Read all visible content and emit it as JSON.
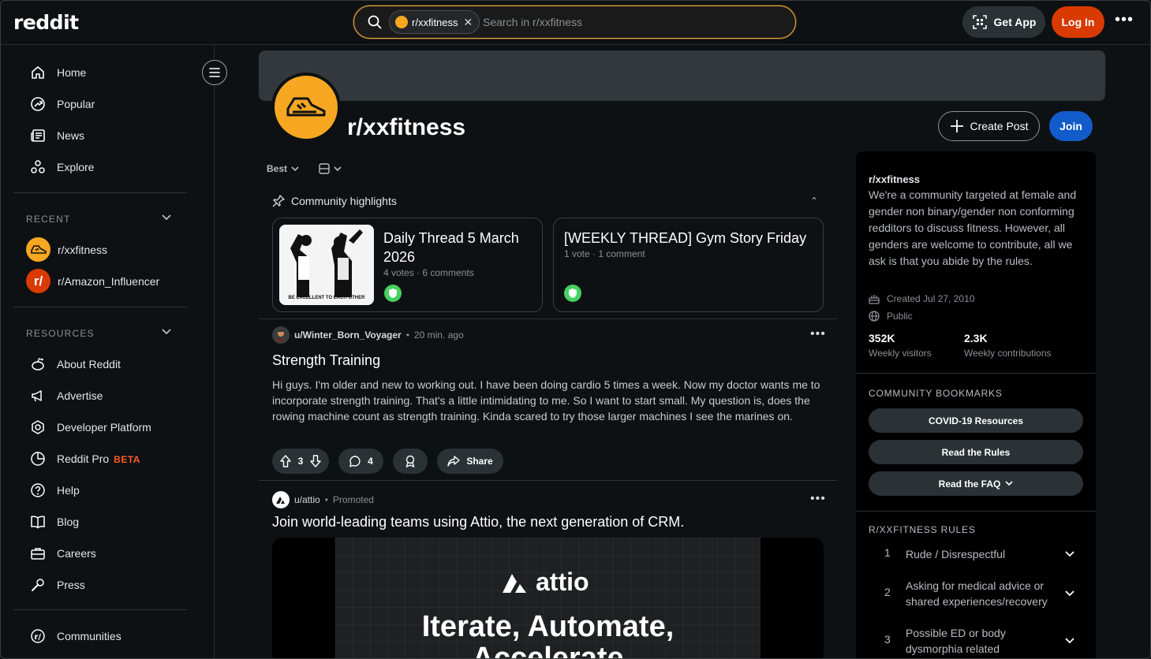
{
  "header": {
    "logo": "reddit",
    "search_chip": "r/xxfitness",
    "search_placeholder": "Search in r/xxfitness",
    "get_app": "Get App",
    "login": "Log In"
  },
  "sidebar": {
    "nav": [
      "Home",
      "Popular",
      "News",
      "Explore"
    ],
    "recent_label": "RECENT",
    "recent": [
      "r/xxfitness",
      "r/Amazon_Influencer"
    ],
    "resources_label": "RESOURCES",
    "resources": [
      "About Reddit",
      "Advertise",
      "Developer Platform",
      "Reddit Pro",
      "Help",
      "Blog",
      "Careers",
      "Press"
    ],
    "beta_label": "BETA",
    "communities": "Communities"
  },
  "subreddit": {
    "name": "r/xxfitness",
    "create_post": "Create Post",
    "join": "Join"
  },
  "feed": {
    "sort": "Best",
    "highlights_label": "Community highlights",
    "highlights": [
      {
        "title": "Daily Thread 5 March 2026",
        "meta": "4 votes · 6 comments",
        "thumb_caption": "BE EXCELLENT TO EACH OTHER"
      },
      {
        "title": "[WEEKLY THREAD] Gym Story Friday",
        "meta": "1 vote · 1 comment"
      }
    ],
    "post": {
      "user": "u/Winter_Born_Voyager",
      "time": "20 min. ago",
      "title": "Strength Training",
      "body": "Hi guys. I'm older and new to working out. I have been doing cardio 5 times a week. Now my doctor wants me to incorporate strength training. That's a little intimidating to me. So I want to start small. My question is, does the rowing machine count as strength training. Kinda scared to try those larger machines I see the marines on.",
      "votes": "3",
      "comments": "4",
      "share": "Share"
    },
    "ad": {
      "user": "u/attio",
      "tag": "Promoted",
      "title": "Join world-leading teams using Attio, the next generation of CRM.",
      "brand": "attio",
      "headline_1": "Iterate, Automate,",
      "headline_2": "Accelerate"
    }
  },
  "about": {
    "name": "r/xxfitness",
    "description": "We're a community targeted at female and gender non binary/gender non conforming redditors to discuss fitness. However, all genders are welcome to contribute, all we ask is that you abide by the rules.",
    "created": "Created Jul 27, 2010",
    "visibility": "Public",
    "weekly_visitors": "352K",
    "weekly_visitors_label": "Weekly visitors",
    "weekly_contributions": "2.3K",
    "weekly_contributions_label": "Weekly contributions",
    "bookmarks_label": "COMMUNITY BOOKMARKS",
    "bookmarks": [
      "COVID-19 Resources",
      "Read the Rules",
      "Read the FAQ"
    ],
    "rules_label": "R/XXFITNESS RULES",
    "rules": [
      {
        "num": "1",
        "text": "Rude / Disrespectful"
      },
      {
        "num": "2",
        "text": "Asking for medical advice or shared experiences/recovery"
      },
      {
        "num": "3",
        "text": "Possible ED or body dysmorphia related"
      }
    ]
  },
  "colors": {
    "accent_orange": "#d93a00",
    "join_blue": "#115bca",
    "sub_avatar": "#f7a721",
    "mod_green": "#46d160"
  }
}
